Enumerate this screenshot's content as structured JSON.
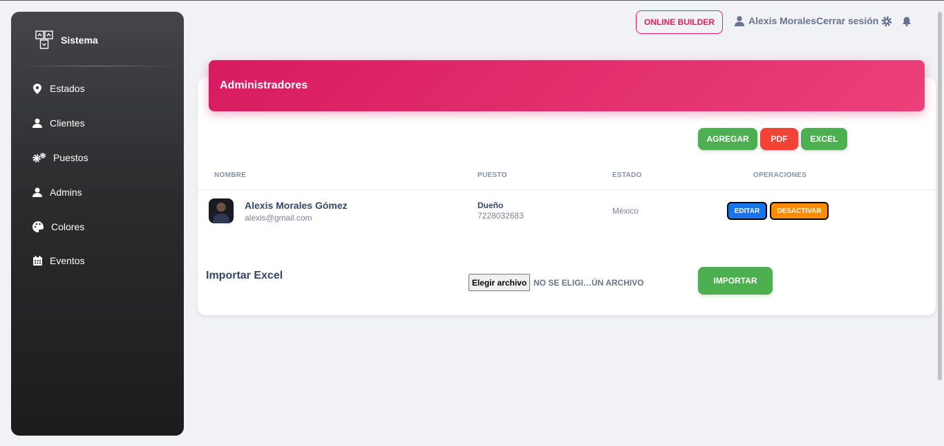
{
  "sidebar": {
    "brand": "Sistema",
    "items": [
      {
        "label": "Estados",
        "icon": "map-pin-icon"
      },
      {
        "label": "Clientes",
        "icon": "user-icon"
      },
      {
        "label": "Puestos",
        "icon": "gears-icon"
      },
      {
        "label": "Admins",
        "icon": "user-icon"
      },
      {
        "label": "Colores",
        "icon": "palette-icon"
      },
      {
        "label": "Eventos",
        "icon": "calendar-icon"
      }
    ]
  },
  "topbar": {
    "online_builder": "ONLINE BUILDER",
    "user_name": "Alexis Morales",
    "logout": "Cerrar sesión"
  },
  "card": {
    "title": "Administradores",
    "actions": {
      "add": "AGREGAR",
      "pdf": "PDF",
      "excel": "EXCEL"
    },
    "columns": {
      "name": "NOMBRE",
      "role": "PUESTO",
      "state": "ESTADO",
      "ops": "OPERACIONES"
    },
    "rows": [
      {
        "name": "Alexis Morales Gómez",
        "email": "alexis@gmail.com",
        "role": "Dueño",
        "phone": "7228032683",
        "state": "México",
        "edit": "EDITAR",
        "deactivate": "DESACTIVAR"
      }
    ],
    "import": {
      "title": "Importar Excel",
      "choose_file": "Elegir archivo",
      "file_status": "NO SE ELIGI…ÚN ARCHIVO",
      "import_button": "IMPORTAR"
    }
  },
  "colors": {
    "primary": "#e91e63",
    "success": "#4caf50",
    "danger": "#f44335",
    "info": "#1a73e8",
    "warning": "#fb8c00"
  }
}
